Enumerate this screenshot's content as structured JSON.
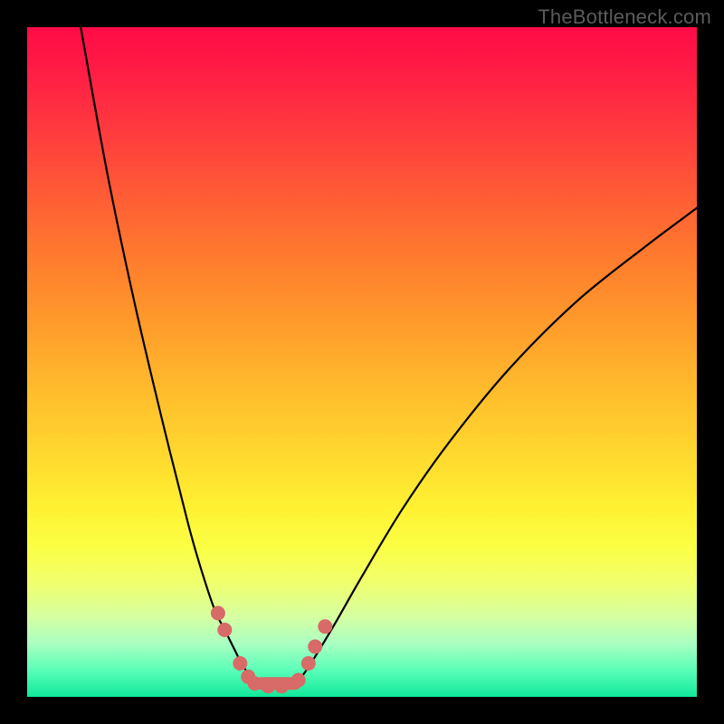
{
  "watermark": "TheBottleneck.com",
  "chart_data": {
    "type": "line",
    "title": "",
    "xlabel": "",
    "ylabel": "",
    "xlim": [
      0,
      100
    ],
    "ylim": [
      0,
      100
    ],
    "series": [
      {
        "name": "curve-left",
        "x": [
          8,
          12,
          16,
          20,
          24,
          26,
          28,
          29.5,
          31,
          32,
          33,
          34,
          35
        ],
        "y": [
          100,
          78,
          59,
          42,
          26,
          19,
          13,
          10,
          7,
          5,
          3.5,
          2.5,
          2
        ]
      },
      {
        "name": "curve-right",
        "x": [
          40,
          41,
          43,
          46,
          50,
          56,
          63,
          72,
          82,
          92,
          100
        ],
        "y": [
          2,
          3,
          6,
          11,
          18,
          28,
          38,
          49,
          59,
          67,
          73
        ]
      },
      {
        "name": "markers-left",
        "x": [
          28.5,
          29.5,
          31.8,
          33.0,
          34.0,
          36.0,
          38.0
        ],
        "y": [
          12.5,
          10.0,
          5.0,
          3.0,
          2.0,
          1.6,
          1.6
        ]
      },
      {
        "name": "markers-right",
        "x": [
          40.5,
          42.0,
          43.0,
          44.5
        ],
        "y": [
          2.5,
          5.0,
          7.5,
          10.5
        ]
      }
    ],
    "marker_color": "#d86a67",
    "line_color": "#000000"
  }
}
